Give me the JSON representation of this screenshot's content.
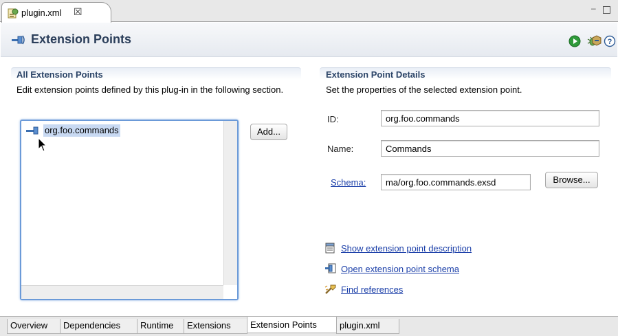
{
  "editor": {
    "tab_title": "plugin.xml",
    "close_glyph": "☒",
    "min_glyph": "–"
  },
  "header": {
    "title": "Extension Points",
    "actions": [
      "run-icon",
      "debug-icon",
      "export-icon",
      "help-icon"
    ]
  },
  "left_section": {
    "title": "All Extension Points",
    "description": "Edit extension points defined by this plug-in in the following section.",
    "tree_items": [
      "org.foo.commands"
    ],
    "add_label": "Add..."
  },
  "right_section": {
    "title": "Extension Point Details",
    "description": "Set the properties of the selected extension point.",
    "id_label": "ID:",
    "id_value": "org.foo.commands",
    "name_label": "Name:",
    "name_value": "Commands",
    "schema_label": "Schema:",
    "schema_value": "ma/org.foo.commands.exsd",
    "browse_label": "Browse...",
    "links": [
      "Show extension point description",
      "Open extension point schema",
      "Find references"
    ]
  },
  "bottom_tabs": [
    "Overview",
    "Dependencies",
    "Runtime",
    "Extensions",
    "Extension Points",
    "plugin.xml"
  ],
  "active_bottom_tab": "Extension Points",
  "colors": {
    "accent": "#2b4467",
    "link": "#1a3ea8",
    "selection": "#c8d9f2",
    "focus_border": "#6b9ad8"
  }
}
